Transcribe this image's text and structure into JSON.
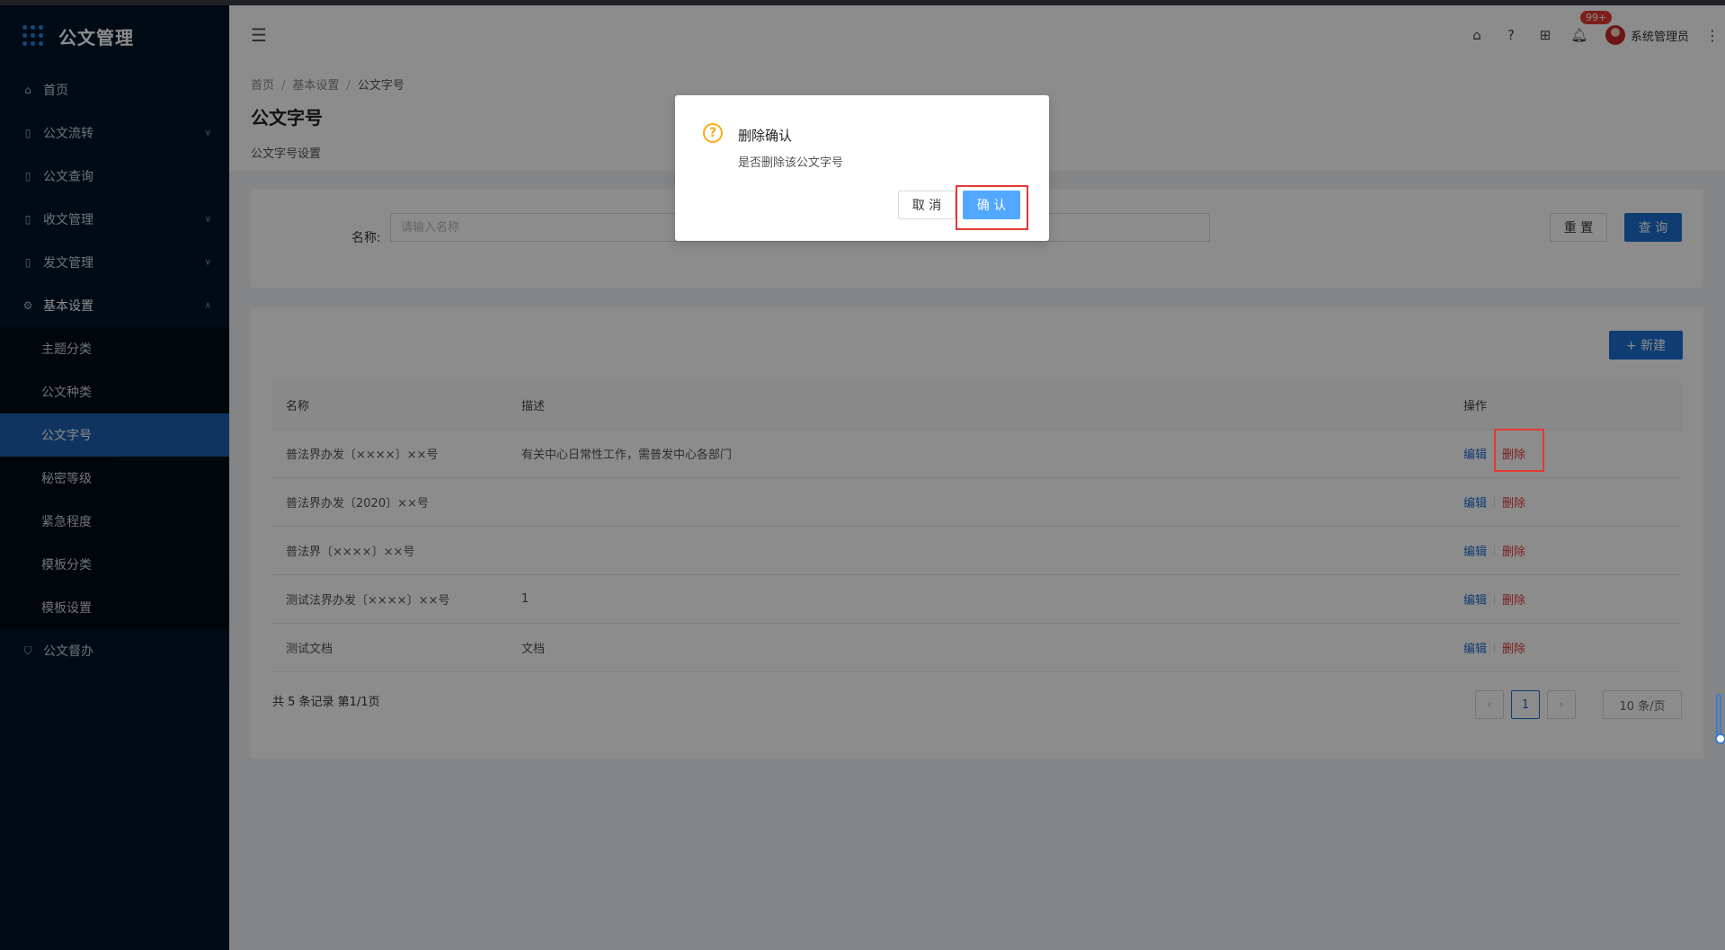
{
  "app": {
    "title": "公文管理"
  },
  "sidebar": {
    "items": [
      {
        "label": "首页",
        "icon": "home-icon"
      },
      {
        "label": "公文流转",
        "icon": "doc-flow-icon"
      },
      {
        "label": "公文查询",
        "icon": "doc-search-icon"
      },
      {
        "label": "收文管理",
        "icon": "inbox-doc-icon"
      },
      {
        "label": "发文管理",
        "icon": "send-doc-icon"
      },
      {
        "label": "基本设置",
        "icon": "gear-icon"
      },
      {
        "label": "公文督办",
        "icon": "shield-icon"
      }
    ],
    "submenu": [
      {
        "label": "主题分类"
      },
      {
        "label": "公文种类"
      },
      {
        "label": "公文字号"
      },
      {
        "label": "秘密等级"
      },
      {
        "label": "紧急程度"
      },
      {
        "label": "模板分类"
      },
      {
        "label": "模板设置"
      }
    ]
  },
  "header": {
    "notification_count": "99+",
    "username": "系统管理员"
  },
  "breadcrumb": [
    "首页",
    "基本设置",
    "公文字号"
  ],
  "page": {
    "title": "公文字号",
    "subtitle": "公文字号设置"
  },
  "search": {
    "label": "名称:",
    "placeholder": "请输入名称",
    "reset_label": "重 置",
    "query_label": "查 询"
  },
  "table": {
    "new_label": "+ 新建",
    "columns": [
      "名称",
      "描述",
      "操作"
    ],
    "rows": [
      {
        "name": "普法界办发〔××××〕××号",
        "desc": "有关中心日常性工作，需普发中心各部门"
      },
      {
        "name": "普法界办发〔2020〕××号",
        "desc": ""
      },
      {
        "name": "普法界〔××××〕××号",
        "desc": ""
      },
      {
        "name": "测试法界办发〔××××〕××号",
        "desc": "1"
      },
      {
        "name": "测试文档",
        "desc": "文档"
      }
    ],
    "edit_label": "编辑",
    "delete_label": "删除",
    "total_text": "共 5 条记录 第1/1页",
    "current_page": "1",
    "page_size": "10 条/页"
  },
  "modal": {
    "title": "删除确认",
    "content": "是否删除该公文字号",
    "cancel_label": "取 消",
    "ok_label": "确 认"
  },
  "colors": {
    "sidebar_bg": "#001529",
    "primary": "#1d6fd1",
    "danger": "#e53935",
    "warning": "#faad14"
  }
}
